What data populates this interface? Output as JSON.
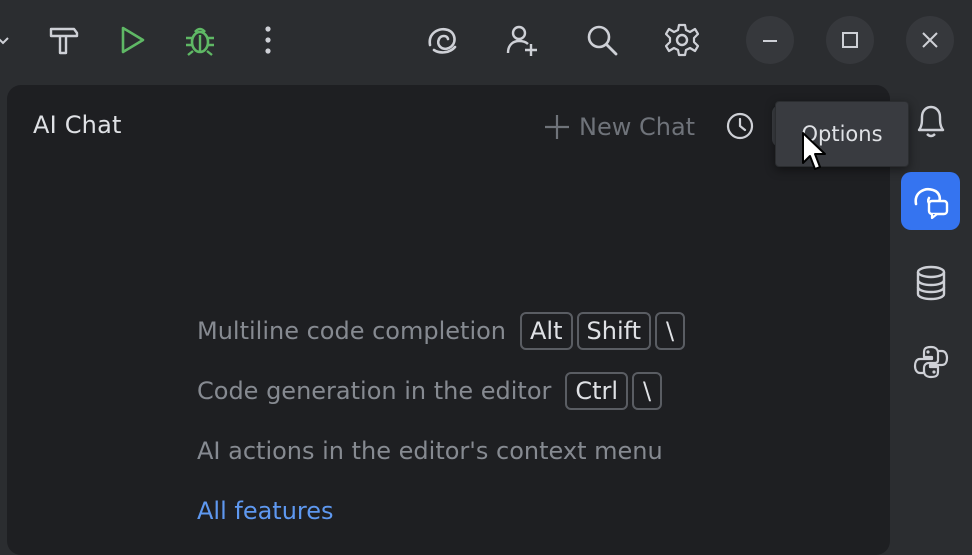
{
  "toolbar": {
    "buttons": [
      {
        "name": "build",
        "icon": "hammer-icon"
      },
      {
        "name": "run",
        "icon": "play-icon",
        "color": "#5fb865"
      },
      {
        "name": "debug",
        "icon": "bug-icon",
        "color": "#5fb865"
      },
      {
        "name": "more",
        "icon": "more-vertical-icon"
      },
      {
        "name": "ai-assistant",
        "icon": "ai-spiral-icon"
      },
      {
        "name": "code-with-me",
        "icon": "add-user-icon"
      },
      {
        "name": "search",
        "icon": "search-icon"
      },
      {
        "name": "settings",
        "icon": "gear-icon"
      }
    ],
    "window_controls": [
      "minimize-icon",
      "maximize-icon",
      "close-icon"
    ]
  },
  "panel": {
    "title": "AI Chat",
    "new_chat_label": "New Chat",
    "icons": [
      "history-icon",
      "more-vertical-icon",
      "minimize-panel-icon"
    ]
  },
  "tooltip": {
    "text": "Options"
  },
  "hints": [
    {
      "text": "Multiline code completion",
      "keys": [
        "Alt",
        "Shift",
        "\\"
      ]
    },
    {
      "text": "Code generation in the editor",
      "keys": [
        "Ctrl",
        "\\"
      ]
    },
    {
      "text": "AI actions in the editor's context menu",
      "keys": []
    }
  ],
  "all_features_link": "All features",
  "right_strip": [
    {
      "name": "notifications",
      "icon": "bell-icon"
    },
    {
      "name": "ai-chat",
      "icon": "ai-chat-icon",
      "active": true
    },
    {
      "name": "database",
      "icon": "database-icon"
    },
    {
      "name": "python",
      "icon": "python-icon"
    }
  ],
  "colors": {
    "background": "#2b2d30",
    "panel": "#1e1f22",
    "accent": "#3574f0",
    "link": "#5e98f0",
    "run_green": "#5fb865"
  }
}
